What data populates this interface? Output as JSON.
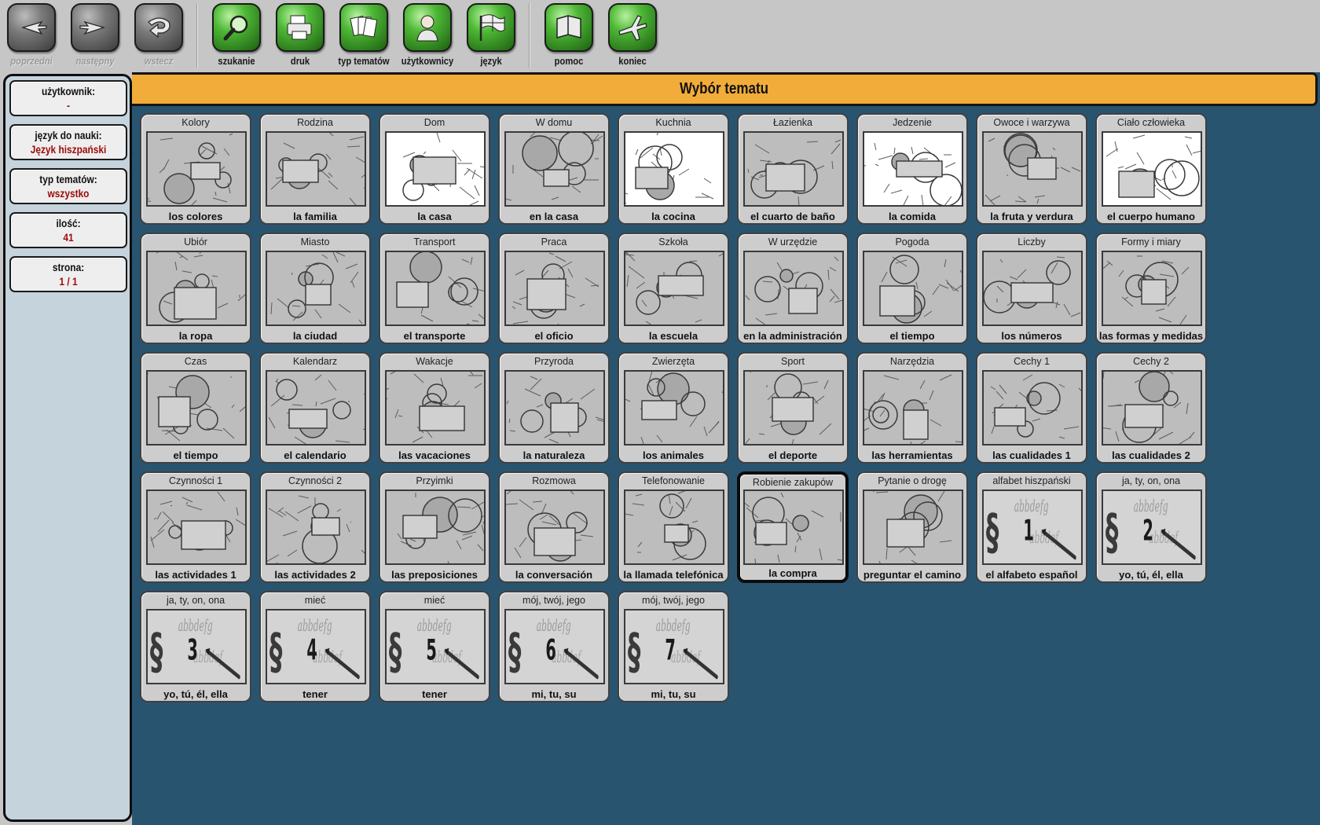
{
  "toolbar": {
    "nav": [
      {
        "id": "poprzedni",
        "label": "poprzedni",
        "icon": "arrow-left-icon",
        "enabled": false
      },
      {
        "id": "nastepny",
        "label": "następny",
        "icon": "arrow-right-icon",
        "enabled": false
      },
      {
        "id": "wstecz",
        "label": "wstecz",
        "icon": "back-curve-icon",
        "enabled": false
      }
    ],
    "tools": [
      {
        "id": "szukanie",
        "label": "szukanie",
        "icon": "magnifier-icon"
      },
      {
        "id": "druk",
        "label": "druk",
        "icon": "printer-icon"
      },
      {
        "id": "typ-tematow",
        "label": "typ tematów",
        "icon": "documents-icon"
      },
      {
        "id": "uzytkownicy",
        "label": "użytkownicy",
        "icon": "user-icon"
      },
      {
        "id": "jezyk",
        "label": "język",
        "icon": "flag-icon"
      }
    ],
    "help": [
      {
        "id": "pomoc",
        "label": "pomoc",
        "icon": "book-icon"
      },
      {
        "id": "koniec",
        "label": "koniec",
        "icon": "airplane-icon"
      }
    ]
  },
  "sidebar": {
    "user_label": "użytkownik:",
    "user_value": "-",
    "lang_label": "język do nauki:",
    "lang_value": "Język hiszpański",
    "type_label": "typ tematów:",
    "type_value": "wszystko",
    "count_label": "ilość:",
    "count_value": "41",
    "page_label": "strona:",
    "page_value": "1 / 1"
  },
  "title": "Wybór tematu",
  "colors": {
    "accent": "#f2ac39",
    "main_bg": "#295470",
    "sidebar_bg": "#c5d3dc",
    "value_red": "#9c0a0a"
  },
  "topics": [
    {
      "title": "Kolory",
      "caption": "los colores",
      "icon": "palette-icon"
    },
    {
      "title": "Rodzina",
      "caption": "la familia",
      "icon": "family-icon"
    },
    {
      "title": "Dom",
      "caption": "la casa",
      "icon": "house-icon"
    },
    {
      "title": "W domu",
      "caption": "en la casa",
      "icon": "household-items-icon"
    },
    {
      "title": "Kuchnia",
      "caption": "la cocina",
      "icon": "kitchen-icon"
    },
    {
      "title": "Łazienka",
      "caption": "el cuarto de baño",
      "icon": "bathroom-icon"
    },
    {
      "title": "Jedzenie",
      "caption": "la comida",
      "icon": "food-icon"
    },
    {
      "title": "Owoce i warzywa",
      "caption": "la fruta y verdura",
      "icon": "fruit-basket-icon"
    },
    {
      "title": "Ciało człowieka",
      "caption": "el cuerpo humano",
      "icon": "face-icon"
    },
    {
      "title": "Ubiór",
      "caption": "la ropa",
      "icon": "sweater-icon"
    },
    {
      "title": "Miasto",
      "caption": "la ciudad",
      "icon": "city-icon"
    },
    {
      "title": "Transport",
      "caption": "el transporte",
      "icon": "transport-icon"
    },
    {
      "title": "Praca",
      "caption": "el oficio",
      "icon": "workers-icon"
    },
    {
      "title": "Szkoła",
      "caption": "la escuela",
      "icon": "schoolbag-icon"
    },
    {
      "title": "W urzędzie",
      "caption": "en la administración",
      "icon": "office-icon"
    },
    {
      "title": "Pogoda",
      "caption": "el tiempo",
      "icon": "storm-icon"
    },
    {
      "title": "Liczby",
      "caption": "los números",
      "icon": "numbers-icon"
    },
    {
      "title": "Formy i miary",
      "caption": "las formas y medidas",
      "icon": "shapes-icon"
    },
    {
      "title": "Czas",
      "caption": "el tiempo",
      "icon": "clock-icon"
    },
    {
      "title": "Kalendarz",
      "caption": "el calendario",
      "icon": "calendar-icon"
    },
    {
      "title": "Wakacje",
      "caption": "las vacaciones",
      "icon": "tent-icon"
    },
    {
      "title": "Przyroda",
      "caption": "la  naturaleza",
      "icon": "landscape-icon"
    },
    {
      "title": "Zwierzęta",
      "caption": "los animales",
      "icon": "pig-icon"
    },
    {
      "title": "Sport",
      "caption": "el deporte",
      "icon": "sport-icon"
    },
    {
      "title": "Narzędzia",
      "caption": "las herramientas",
      "icon": "tools-icon"
    },
    {
      "title": "Cechy 1",
      "caption": "las cualidades 1",
      "icon": "qualities-1-icon"
    },
    {
      "title": "Cechy 2",
      "caption": "las cualidades 2",
      "icon": "qualities-2-icon"
    },
    {
      "title": "Czynności 1",
      "caption": "las actividades 1",
      "icon": "door-1-icon"
    },
    {
      "title": "Czynności 2",
      "caption": "las actividades 2",
      "icon": "door-2-icon"
    },
    {
      "title": "Przyimki",
      "caption": "las preposiciones",
      "icon": "cat-basket-icon"
    },
    {
      "title": "Rozmowa",
      "caption": "la conversación",
      "icon": "conversation-icon"
    },
    {
      "title": "Telefonowanie",
      "caption": "la llamada telefónica",
      "icon": "phone-call-icon"
    },
    {
      "title": "Robienie zakupów",
      "caption": "la compra",
      "icon": "shopping-cart-icon",
      "selected": true
    },
    {
      "title": "Pytanie o drogę",
      "caption": "preguntar el camino",
      "icon": "signpost-icon"
    },
    {
      "title": "alfabet hiszpański",
      "caption": "el alfabeto español",
      "icon": "grammar-1-icon",
      "grammar": "1"
    },
    {
      "title": "ja, ty, on, ona",
      "caption": "yo, tú, él, ella",
      "icon": "grammar-2-icon",
      "grammar": "2"
    },
    {
      "title": "ja, ty, on, ona",
      "caption": "yo, tú, él, ella",
      "icon": "grammar-3-icon",
      "grammar": "3"
    },
    {
      "title": "mieć",
      "caption": "tener",
      "icon": "grammar-4-icon",
      "grammar": "4"
    },
    {
      "title": "mieć",
      "caption": "tener",
      "icon": "grammar-5-icon",
      "grammar": "5"
    },
    {
      "title": "mój, twój, jego",
      "caption": "mi, tu, su",
      "icon": "grammar-6-icon",
      "grammar": "6"
    },
    {
      "title": "mój, twój, jego",
      "caption": "mi, tu, su",
      "icon": "grammar-7-icon",
      "grammar": "7"
    }
  ]
}
